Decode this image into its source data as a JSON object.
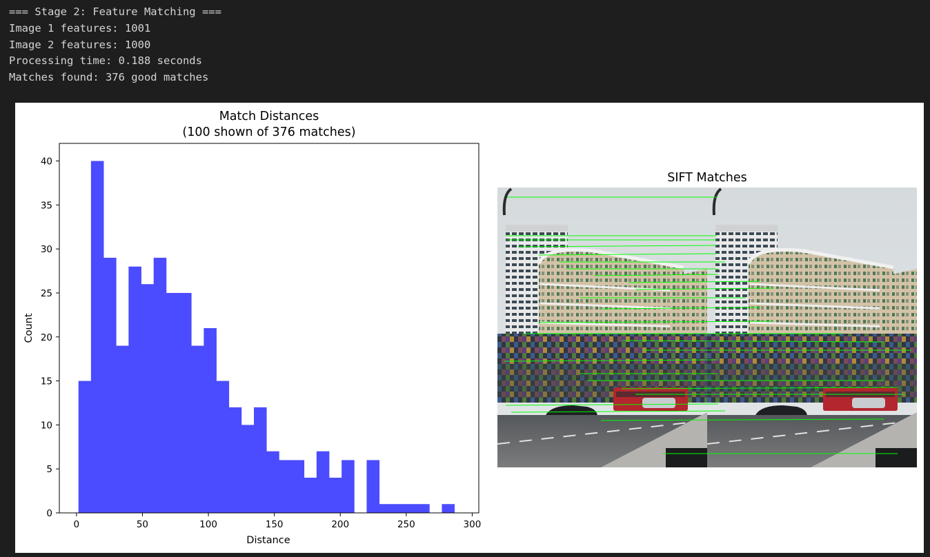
{
  "console": {
    "lines": [
      "=== Stage 2: Feature Matching ===",
      "Image 1 features: 1001",
      "Image 2 features: 1000",
      "Processing time: 0.188 seconds",
      "Matches found: 376 good matches"
    ]
  },
  "histogram": {
    "title_line1": "Match Distances",
    "title_line2": "(100 shown of 376 matches)",
    "xlabel": "Distance",
    "ylabel": "Count"
  },
  "matches_panel": {
    "title": "SIFT Matches",
    "line_color": "#00ff00"
  },
  "chart_data": {
    "type": "bar",
    "title": "Match Distances\n(100 shown of 376 matches)",
    "xlabel": "Distance",
    "ylabel": "Count",
    "bin_start": 1.5,
    "bin_width": 9.5,
    "values": [
      15,
      40,
      29,
      19,
      28,
      26,
      29,
      25,
      25,
      19,
      21,
      15,
      12,
      10,
      12,
      7,
      6,
      6,
      4,
      7,
      4,
      6,
      0,
      6,
      1,
      1,
      1,
      1,
      0,
      1
    ],
    "xlim": [
      -13,
      305
    ],
    "ylim": [
      0,
      42
    ],
    "xticks": [
      0,
      50,
      100,
      150,
      200,
      250,
      300
    ],
    "yticks": [
      0,
      5,
      10,
      15,
      20,
      25,
      30,
      35,
      40
    ],
    "bar_color": "#4b4bff"
  }
}
